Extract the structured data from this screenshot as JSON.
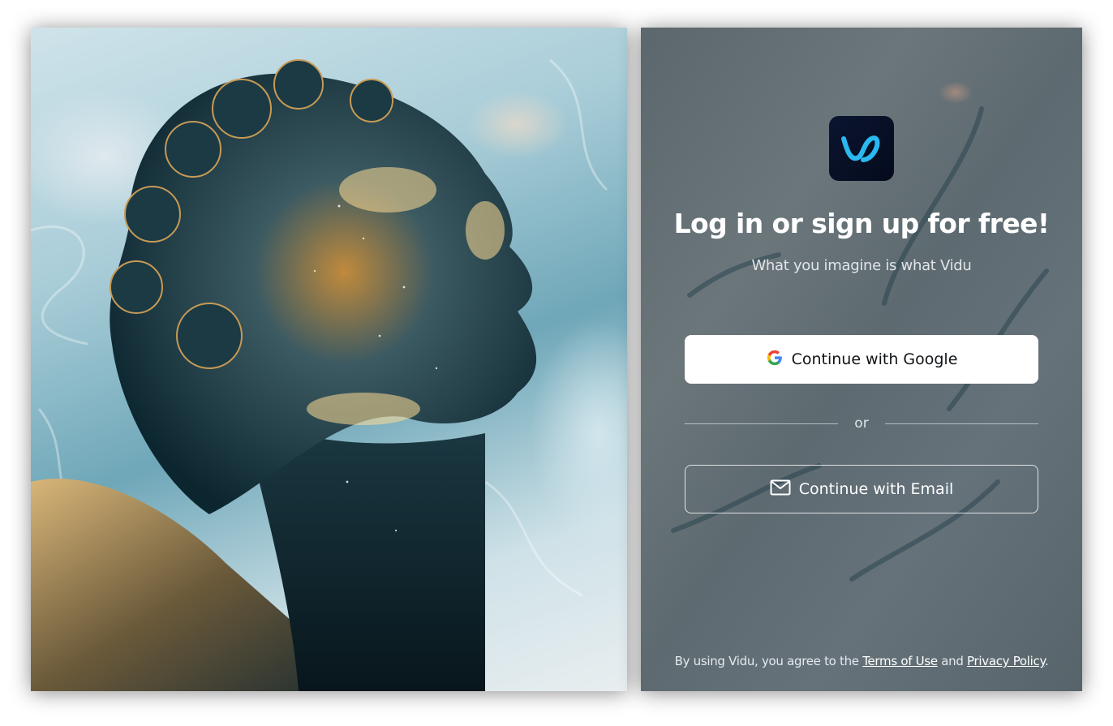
{
  "hero": {
    "image": "statue-head-illustration"
  },
  "login": {
    "logo_icon": "vidu-logo-icon",
    "title": "Log in or sign up for free!",
    "subtitle": "What you imagine is what Vidu",
    "google_button": {
      "label": "Continue with Google",
      "icon": "google-icon"
    },
    "divider_text": "or",
    "email_button": {
      "label": "Continue with Email",
      "icon": "mail-icon"
    },
    "legal": {
      "prefix": "By using Vidu, you agree to the",
      "terms": "Terms of Use",
      "and": "and",
      "privacy": "Privacy Policy",
      "suffix": "."
    }
  },
  "colors": {
    "panel_bg": "#5f6b71",
    "logo_bg": "#0a1226",
    "logo_accent": "#2ab8f0",
    "google_btn_bg": "#ffffff"
  }
}
